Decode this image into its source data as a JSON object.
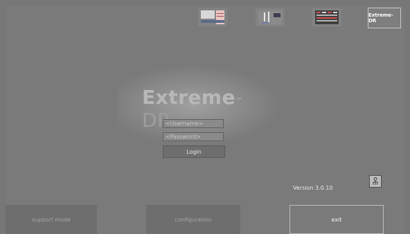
{
  "top_bar": {
    "thumbnails": [
      {
        "name": "thumbnail-report-view"
      },
      {
        "name": "thumbnail-image-view"
      },
      {
        "name": "thumbnail-table-view"
      }
    ],
    "logo_text": "Extreme-DR"
  },
  "login": {
    "brand_main": "Extreme",
    "brand_suffix": "-DR",
    "username_placeholder": "<Username>",
    "password_placeholder": "<Password>",
    "login_label": "Login"
  },
  "version_text": "Version 3.0.10",
  "bottom_nav": {
    "support_label": "support mode",
    "config_label": "configuration",
    "exit_label": "exit"
  },
  "icons": {
    "info": "info-person-icon"
  }
}
